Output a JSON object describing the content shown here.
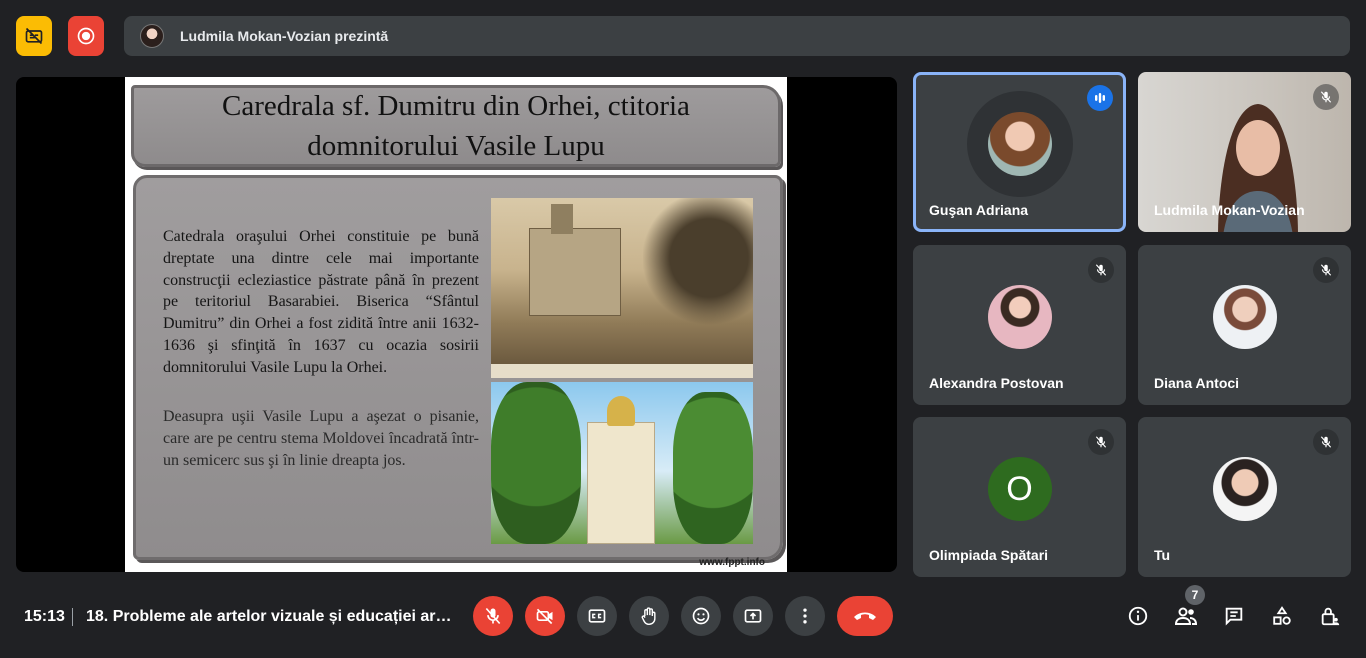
{
  "top_bar": {
    "presenter_label": "Ludmila Mokan-Vozian prezintă",
    "icons": {
      "captions_off": "captions-off-icon",
      "recording": "recording-icon"
    }
  },
  "slide": {
    "title": "Caredrala sf. Dumitru din Orhei, ctitoria domnitorului Vasile Lupu",
    "paragraph1": "Catedrala oraşului Orhei constituie pe bună dreptate una dintre cele mai importante construcţii ecleziastice păstrate până în prezent pe teritoriul Basarabiei. Biserica “Sfântul Dumitru” din Orhei a fost zidită între anii 1632-1636 şi sfinţită în 1637 cu ocazia sosirii domnitorului Vasile Lupu la Orhei.",
    "paragraph2": "Deasupra uşii Vasile Lupu a aşezat o pisanie, care are pe centru stema Moldovei încadrată într-un semicerc sus şi în linie dreapta jos.",
    "footer": "www.fppt.info"
  },
  "participants": [
    {
      "name": "Guşan Adriana",
      "active_speaker": true
    },
    {
      "name": "Ludmila Mokan-Vozian",
      "video": true
    },
    {
      "name": "Alexandra Postovan"
    },
    {
      "name": "Diana Antoci"
    },
    {
      "name": "Olimpiada Spătari",
      "initial": "O",
      "avatar_color": "#2e6b1f"
    },
    {
      "name": "Tu"
    }
  ],
  "bottom_bar": {
    "time": "15:13",
    "meeting_title": "18. Probleme ale artelor vizuale și educației art...",
    "participant_count": "7"
  },
  "colors": {
    "accent_blue": "#8ab4f8",
    "danger_red": "#ea4335",
    "warning_yellow": "#fbbc04",
    "surface": "#3c4043",
    "background": "#202124"
  }
}
